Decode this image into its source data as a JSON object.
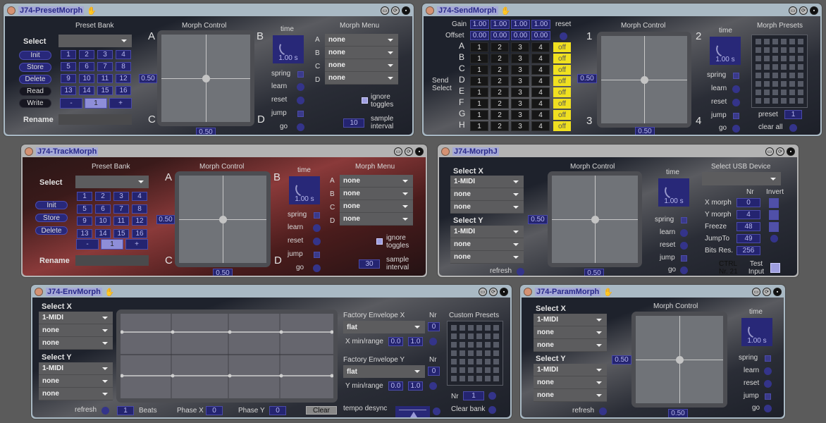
{
  "windows": {
    "preset": {
      "title": "J74-PresetMorph",
      "preset_bank": "Preset Bank",
      "select": "Select",
      "select_value": "",
      "buttons": [
        "Init",
        "Store",
        "Delete",
        "Read",
        "Write"
      ],
      "slots": [
        "1",
        "2",
        "3",
        "4",
        "5",
        "6",
        "7",
        "8",
        "9",
        "10",
        "11",
        "12",
        "13",
        "14",
        "15",
        "16"
      ],
      "minus": "-",
      "current": "1",
      "plus": "+",
      "rename": "Rename",
      "morph_control": "Morph Control",
      "corners": [
        "A",
        "B",
        "C",
        "D"
      ],
      "x_val": "0.50",
      "y_val": "0.50",
      "time": "time",
      "time_val": "1.00 s",
      "opts": [
        "spring",
        "learn",
        "reset",
        "jump",
        "go"
      ],
      "morph_menu": "Morph Menu",
      "menu_rows": [
        {
          "k": "A",
          "v": "none"
        },
        {
          "k": "B",
          "v": "none"
        },
        {
          "k": "C",
          "v": "none"
        },
        {
          "k": "D",
          "v": "none"
        }
      ],
      "ignore": "ignore toggles",
      "sample_val": "10",
      "sample": "sample interval"
    },
    "send": {
      "title": "J74-SendMorph",
      "gain": "Gain",
      "offset": "Offset",
      "gains": [
        "1.00",
        "1.00",
        "1.00",
        "1.00"
      ],
      "offsets": [
        "0.00",
        "0.00",
        "0.00",
        "0.00"
      ],
      "reset": "reset",
      "send_select": "Send Select",
      "rows": [
        "A",
        "B",
        "C",
        "D",
        "E",
        "F",
        "G",
        "H"
      ],
      "cols": [
        "1",
        "2",
        "3",
        "4"
      ],
      "off": "off",
      "morph_control": "Morph Control",
      "corners": [
        "1",
        "2",
        "3",
        "4"
      ],
      "x_val": "0.50",
      "y_val": "0.50",
      "time": "time",
      "time_val": "1.00 s",
      "opts": [
        "spring",
        "learn",
        "reset",
        "jump",
        "go"
      ],
      "morph_presets": "Morph Presets",
      "preset": "preset",
      "preset_val": "1",
      "clear_all": "clear all"
    },
    "track": {
      "title": "J74-TrackMorph",
      "preset_bank": "Preset Bank",
      "select": "Select",
      "buttons": [
        "Init",
        "Store",
        "Delete"
      ],
      "slots": [
        "1",
        "2",
        "3",
        "4",
        "5",
        "6",
        "7",
        "8",
        "9",
        "10",
        "11",
        "12",
        "13",
        "14",
        "15",
        "16"
      ],
      "minus": "-",
      "current": "1",
      "plus": "+",
      "rename": "Rename",
      "morph_control": "Morph Control",
      "corners": [
        "A",
        "B",
        "C",
        "D"
      ],
      "x_val": "0.50",
      "y_val": "0.50",
      "time": "time",
      "time_val": "1.00 s",
      "opts": [
        "spring",
        "learn",
        "reset",
        "jump",
        "go"
      ],
      "morph_menu": "Morph Menu",
      "menu_rows": [
        {
          "k": "A",
          "v": "none"
        },
        {
          "k": "B",
          "v": "none"
        },
        {
          "k": "C",
          "v": "none"
        },
        {
          "k": "D",
          "v": "none"
        }
      ],
      "ignore": "ignore toggles",
      "sample_val": "30",
      "sample": "sample interval"
    },
    "morphj": {
      "title": "J74-MorphJ",
      "select_x": "Select X",
      "x_opts": [
        "1-MIDI",
        "none",
        "none"
      ],
      "select_y": "Select Y",
      "y_opts": [
        "1-MIDI",
        "none",
        "none"
      ],
      "refresh": "refresh",
      "morph_control": "Morph Control",
      "x_val": "0.50",
      "y_val": "0.50",
      "time": "time",
      "time_val": "1.00 s",
      "opts": [
        "spring",
        "learn",
        "reset",
        "jump",
        "go"
      ],
      "usb": "Select USB Device",
      "nr": "Nr",
      "invert": "Invert",
      "params": [
        {
          "k": "X morph",
          "v": "0"
        },
        {
          "k": "Y morph",
          "v": "4"
        },
        {
          "k": "Freeze",
          "v": "48"
        },
        {
          "k": "JumpTo",
          "v": "49"
        },
        {
          "k": "Bits Res.",
          "v": "256"
        }
      ],
      "ctrl": "CTRL Nr. 21",
      "test": "Test Input"
    },
    "env": {
      "title": "J74-EnvMorph",
      "select_x": "Select X",
      "x_opts": [
        "1-MIDI",
        "none",
        "none"
      ],
      "select_y": "Select Y",
      "y_opts": [
        "1-MIDI",
        "none",
        "none"
      ],
      "refresh": "refresh",
      "beats_val": "1",
      "beats": "Beats",
      "phase_x": "Phase X",
      "phase_x_val": "0",
      "phase_y": "Phase Y",
      "phase_y_val": "0",
      "clear": "Clear",
      "fx": "Factory Envelope X",
      "fx_val": "flat",
      "nr": "Nr",
      "fx_nr": "0",
      "xr": "X min/range",
      "xr_min": "0.0",
      "xr_range": "1.0",
      "fy": "Factory Envelope Y",
      "fy_val": "flat",
      "fy_nr": "0",
      "yr": "Y min/range",
      "yr_min": "0.0",
      "yr_range": "1.0",
      "tempo": "tempo desync",
      "custom": "Custom Presets",
      "cnr": "Nr",
      "cnr_val": "1",
      "clear_bank": "Clear bank"
    },
    "param": {
      "title": "J74-ParamMorph",
      "select_x": "Select X",
      "x_opts": [
        "1-MIDI",
        "none",
        "none"
      ],
      "select_y": "Select Y",
      "y_opts": [
        "1-MIDI",
        "none",
        "none"
      ],
      "refresh": "refresh",
      "morph_control": "Morph Control",
      "x_val": "0.50",
      "y_val": "0.50",
      "time": "time",
      "time_val": "1.00 s",
      "opts": [
        "spring",
        "learn",
        "reset",
        "jump",
        "go"
      ]
    }
  }
}
